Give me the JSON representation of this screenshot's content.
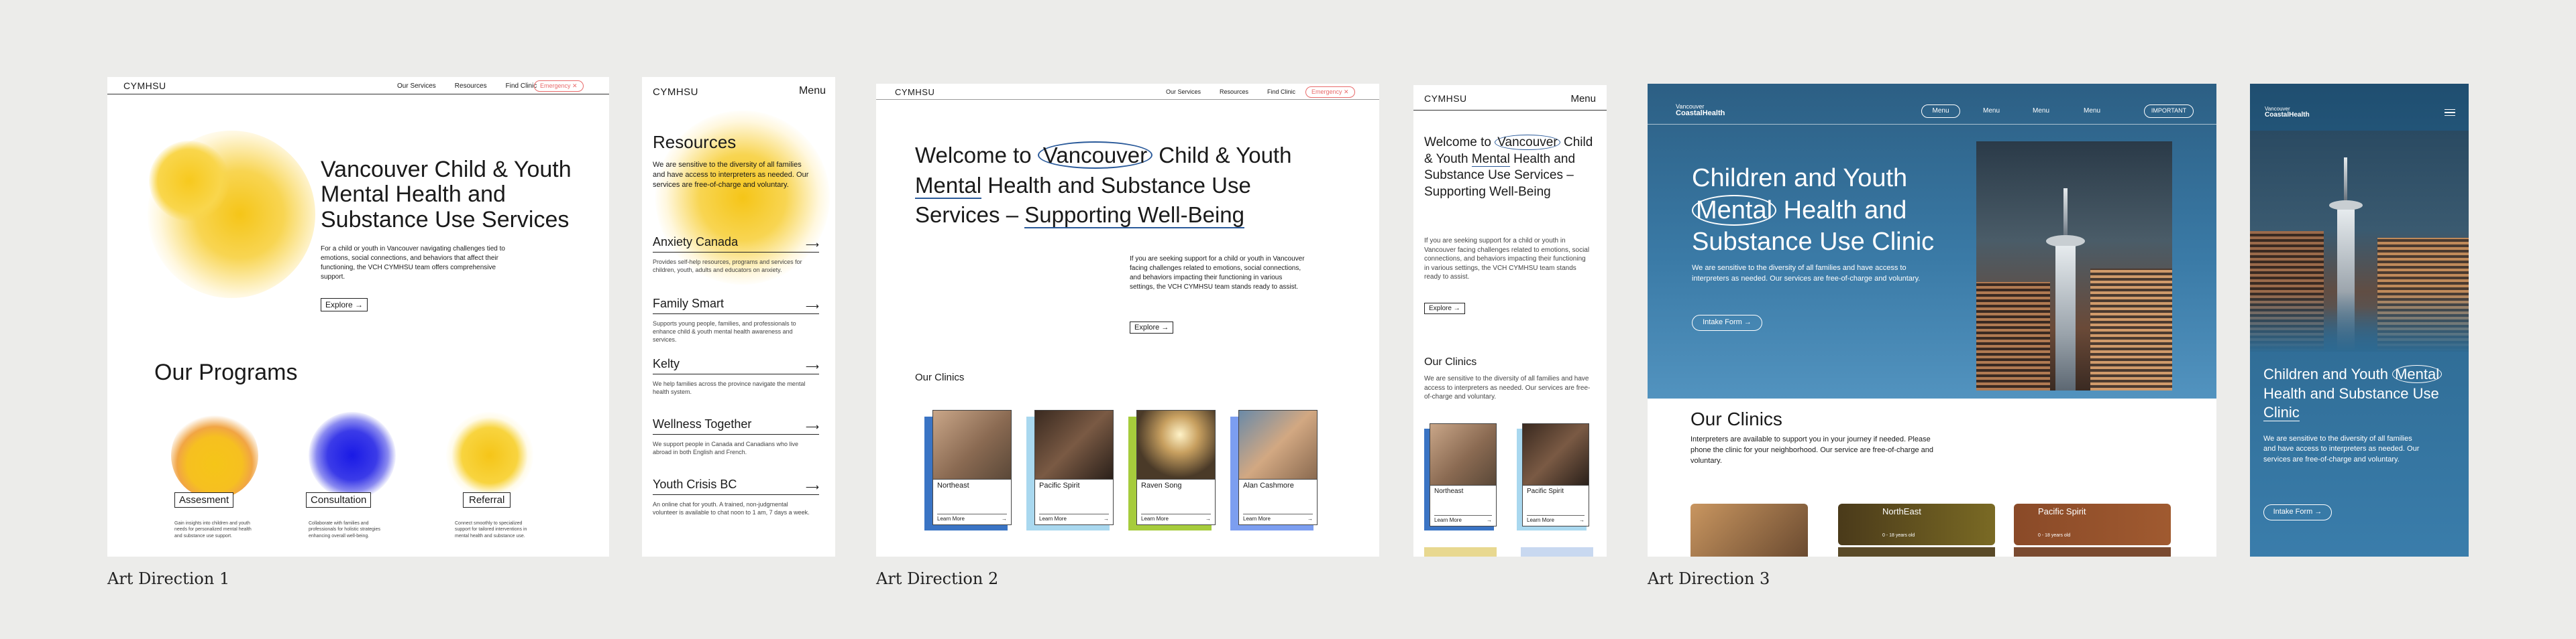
{
  "captions": {
    "ad1": "Art Direction 1",
    "ad2": "Art Direction 2",
    "ad3": "Art Direction 3"
  },
  "ad1": {
    "brand": "CYMHSU",
    "nav": [
      "Our Services",
      "Resources",
      "Find Clinic"
    ],
    "emergency": "Emergency ✕",
    "hero_title": "Vancouver Child & Youth Mental Health and Substance Use Services",
    "hero_text": "For a child or youth in Vancouver navigating challenges tied to emotions, social connections, and behaviors that affect their functioning, the VCH CYMHSU team offers comprehensive support.",
    "explore": "Explore →",
    "programs_title": "Our Programs",
    "programs": [
      {
        "label": "Assesment",
        "desc": "Gain insights into children and youth needs for personalized mental health and substance use support."
      },
      {
        "label": "Consultation",
        "desc": "Collaborate with families and professionals for holistic strategies enhancing overall well-being."
      },
      {
        "label": "Referral",
        "desc": "Connect smoothly to specialized support for tailored interventions in mental health and substance use."
      }
    ],
    "colors": {
      "yellow": "#f5c518",
      "blue": "#2a2ae0",
      "alert": "#e86a6a"
    }
  },
  "ad1m": {
    "brand": "CYMHSU",
    "menu": "Menu",
    "title": "Resources",
    "intro": "We are sensitive to the diversity of all families and have access to interpreters as needed. Our services are free-of-charge and voluntary.",
    "items": [
      {
        "name": "Anxiety Canada",
        "desc": "Provides self-help resources, programs and services for children, youth, adults and educators on anxiety."
      },
      {
        "name": "Family Smart",
        "desc": "Supports young people, families, and professionals to enhance child & youth mental health awareness and services."
      },
      {
        "name": "Kelty",
        "desc": "We help families across the province navigate the mental health system."
      },
      {
        "name": "Wellness Together",
        "desc": "We support people in Canada and Canadians who live abroad in both English and French."
      },
      {
        "name": "Youth Crisis BC",
        "desc": "An online chat for youth. A trained, non-judgmental volunteer is available to chat noon to 1 am, 7 days a week."
      }
    ]
  },
  "ad2": {
    "brand": "CYMHSU",
    "nav": [
      "Our Services",
      "Resources",
      "Find Clinic"
    ],
    "emergency": "Emergency ✕",
    "title_l1a": "Welcome to ",
    "title_l1b": "Vancouver",
    "title_l1c": " Child & Youth",
    "title_l2a": "Mental",
    "title_l2b": " Health and Substance Use",
    "title_l3a": "Services – ",
    "title_l3b": "Supporting Well-Being",
    "hero_text": "If you are seeking support for a child or youth in Vancouver facing challenges related to emotions, social connections, and behaviors impacting their functioning in various settings, the VCH CYMHSU team stands ready to assist.",
    "explore": "Explore →",
    "clinics_title": "Our Clinics",
    "clinics": [
      {
        "name": "Northeast",
        "link": "Learn More",
        "color": "#3a74c4"
      },
      {
        "name": "Pacific Spirit",
        "link": "Learn More",
        "color": "#a9d8ef"
      },
      {
        "name": "Raven Song",
        "link": "Learn More",
        "color": "#a6cc3c"
      },
      {
        "name": "Alan Cashmore",
        "link": "Learn More",
        "color": "#7c9ef0"
      }
    ]
  },
  "ad2m": {
    "brand": "CYMHSU",
    "menu": "Menu",
    "title_a": "Welcome to ",
    "title_b": "Vancouver",
    "title_c": " Child & Youth ",
    "title_d": "Mental",
    "title_e": " Health and Substance Use Services – Supporting Well-Being",
    "hero_text": "If you are seeking support for a child or youth in Vancouver facing challenges related to emotions, social connections, and behaviors impacting their functioning in various settings, the VCH CYMHSU team stands ready to assist.",
    "explore": "Explore →",
    "clinics_title": "Our Clinics",
    "clinics_text": "We are sensitive to the diversity of all families and have access to interpreters as needed. Our services are free-of-charge and voluntary.",
    "clinics": [
      {
        "name": "Northeast",
        "link": "Learn More"
      },
      {
        "name": "Pacific Spirit",
        "link": "Learn More"
      }
    ]
  },
  "ad3": {
    "brand_l1": "Vancouver",
    "brand_l2": "CoastalHealth",
    "nav": [
      "Menu",
      "Menu",
      "Menu",
      "Menu"
    ],
    "important": "IMPORTANT",
    "title_a": "Children and Youth",
    "title_b": "Mental",
    "title_c": " Health and",
    "title_d": "Substance Use Clinic",
    "hero_text": "We are sensitive to the diversity of all families and have access to interpreters as needed. Our services are free-of-charge and voluntary.",
    "intake": "Intake Form →",
    "clinics_title": "Our Clinics",
    "clinics_text": "Interpreters are available to support you in your journey if needed. Please phone the clinic for your neighborhood. Our service are free-of-charge and voluntary.",
    "clinics": [
      {
        "name": "NorthEast",
        "age": "0 - 18 years old"
      },
      {
        "name": "Pacific Spirit",
        "age": "0 - 18 years old"
      }
    ],
    "colors": {
      "blue": "#2f6f9a"
    }
  },
  "ad3m": {
    "brand_l1": "Vancouver",
    "brand_l2": "CoastalHealth",
    "title_a": "Children and Youth ",
    "title_b": "Mental",
    "title_c": " Health and Substance Use ",
    "title_d": "Clinic",
    "hero_text": "We are sensitive to the diversity of all families and have access to interpreters as needed. Our services are free-of-charge and voluntary.",
    "intake": "Intake Form →"
  }
}
